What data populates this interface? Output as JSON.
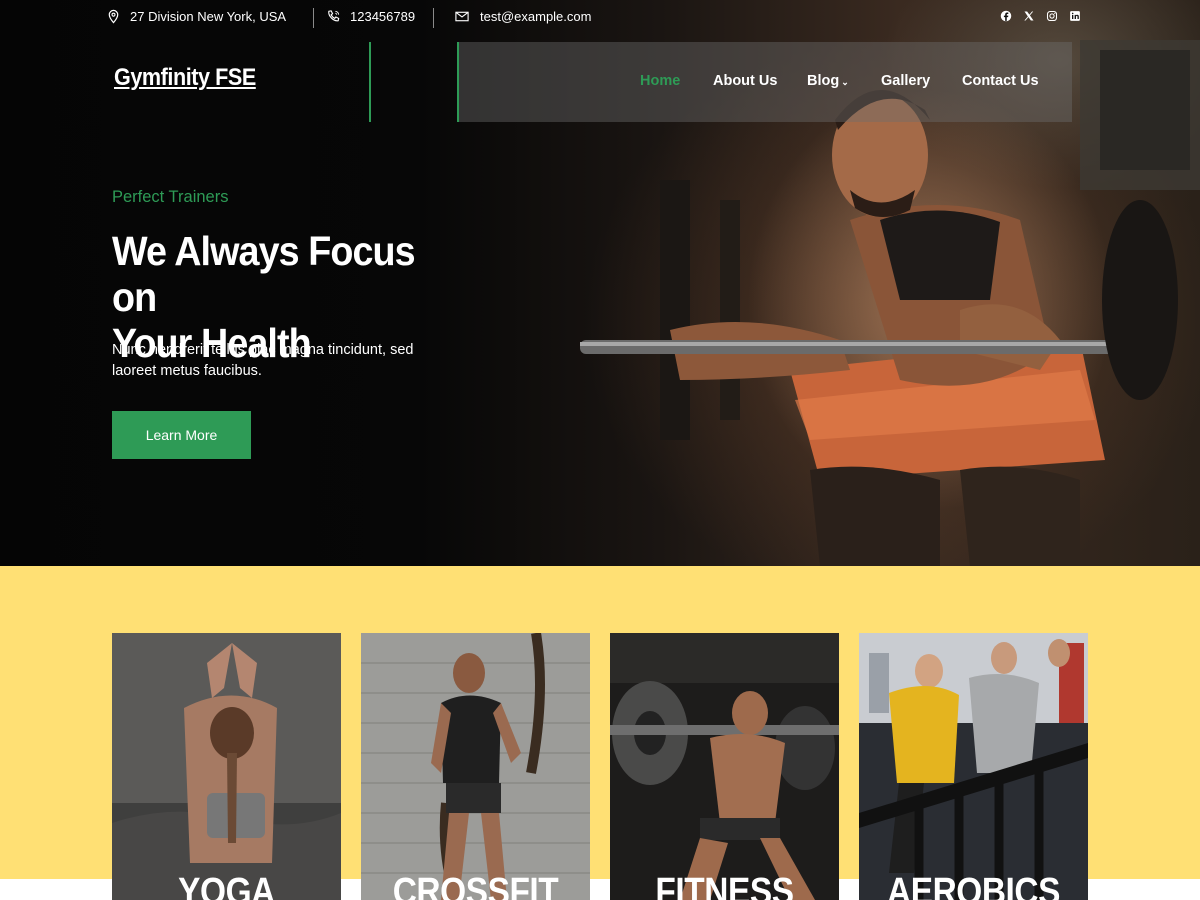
{
  "topbar": {
    "address": "27 Division New York, USA",
    "phone": "123456789",
    "email": "test@example.com",
    "social_icons": [
      "facebook-icon",
      "x-icon",
      "instagram-icon",
      "linkedin-icon"
    ]
  },
  "header": {
    "logo": "Gymfinity FSE",
    "nav": [
      {
        "label": "Home",
        "active": true
      },
      {
        "label": "About Us",
        "active": false
      },
      {
        "label": "Blog",
        "active": false,
        "has_dropdown": true
      },
      {
        "label": "Gallery",
        "active": false
      },
      {
        "label": "Contact Us",
        "active": false
      }
    ]
  },
  "hero": {
    "eyebrow": "Perfect Trainers",
    "headline_line1": "We Always Focus on",
    "headline_line2": "Your Health",
    "subtext": "Nunc hendrerit tellus plac magna tincidunt, sed laoreet metus faucibus.",
    "cta_label": "Learn More"
  },
  "classes": {
    "cards": [
      {
        "label": "YOGA"
      },
      {
        "label": "CROSSFIT"
      },
      {
        "label": "FITNESS"
      },
      {
        "label": "AEROBICS"
      }
    ]
  },
  "colors": {
    "accent": "#2e9b56",
    "section_bg": "#ffe074",
    "hero_bg": "#050505"
  }
}
